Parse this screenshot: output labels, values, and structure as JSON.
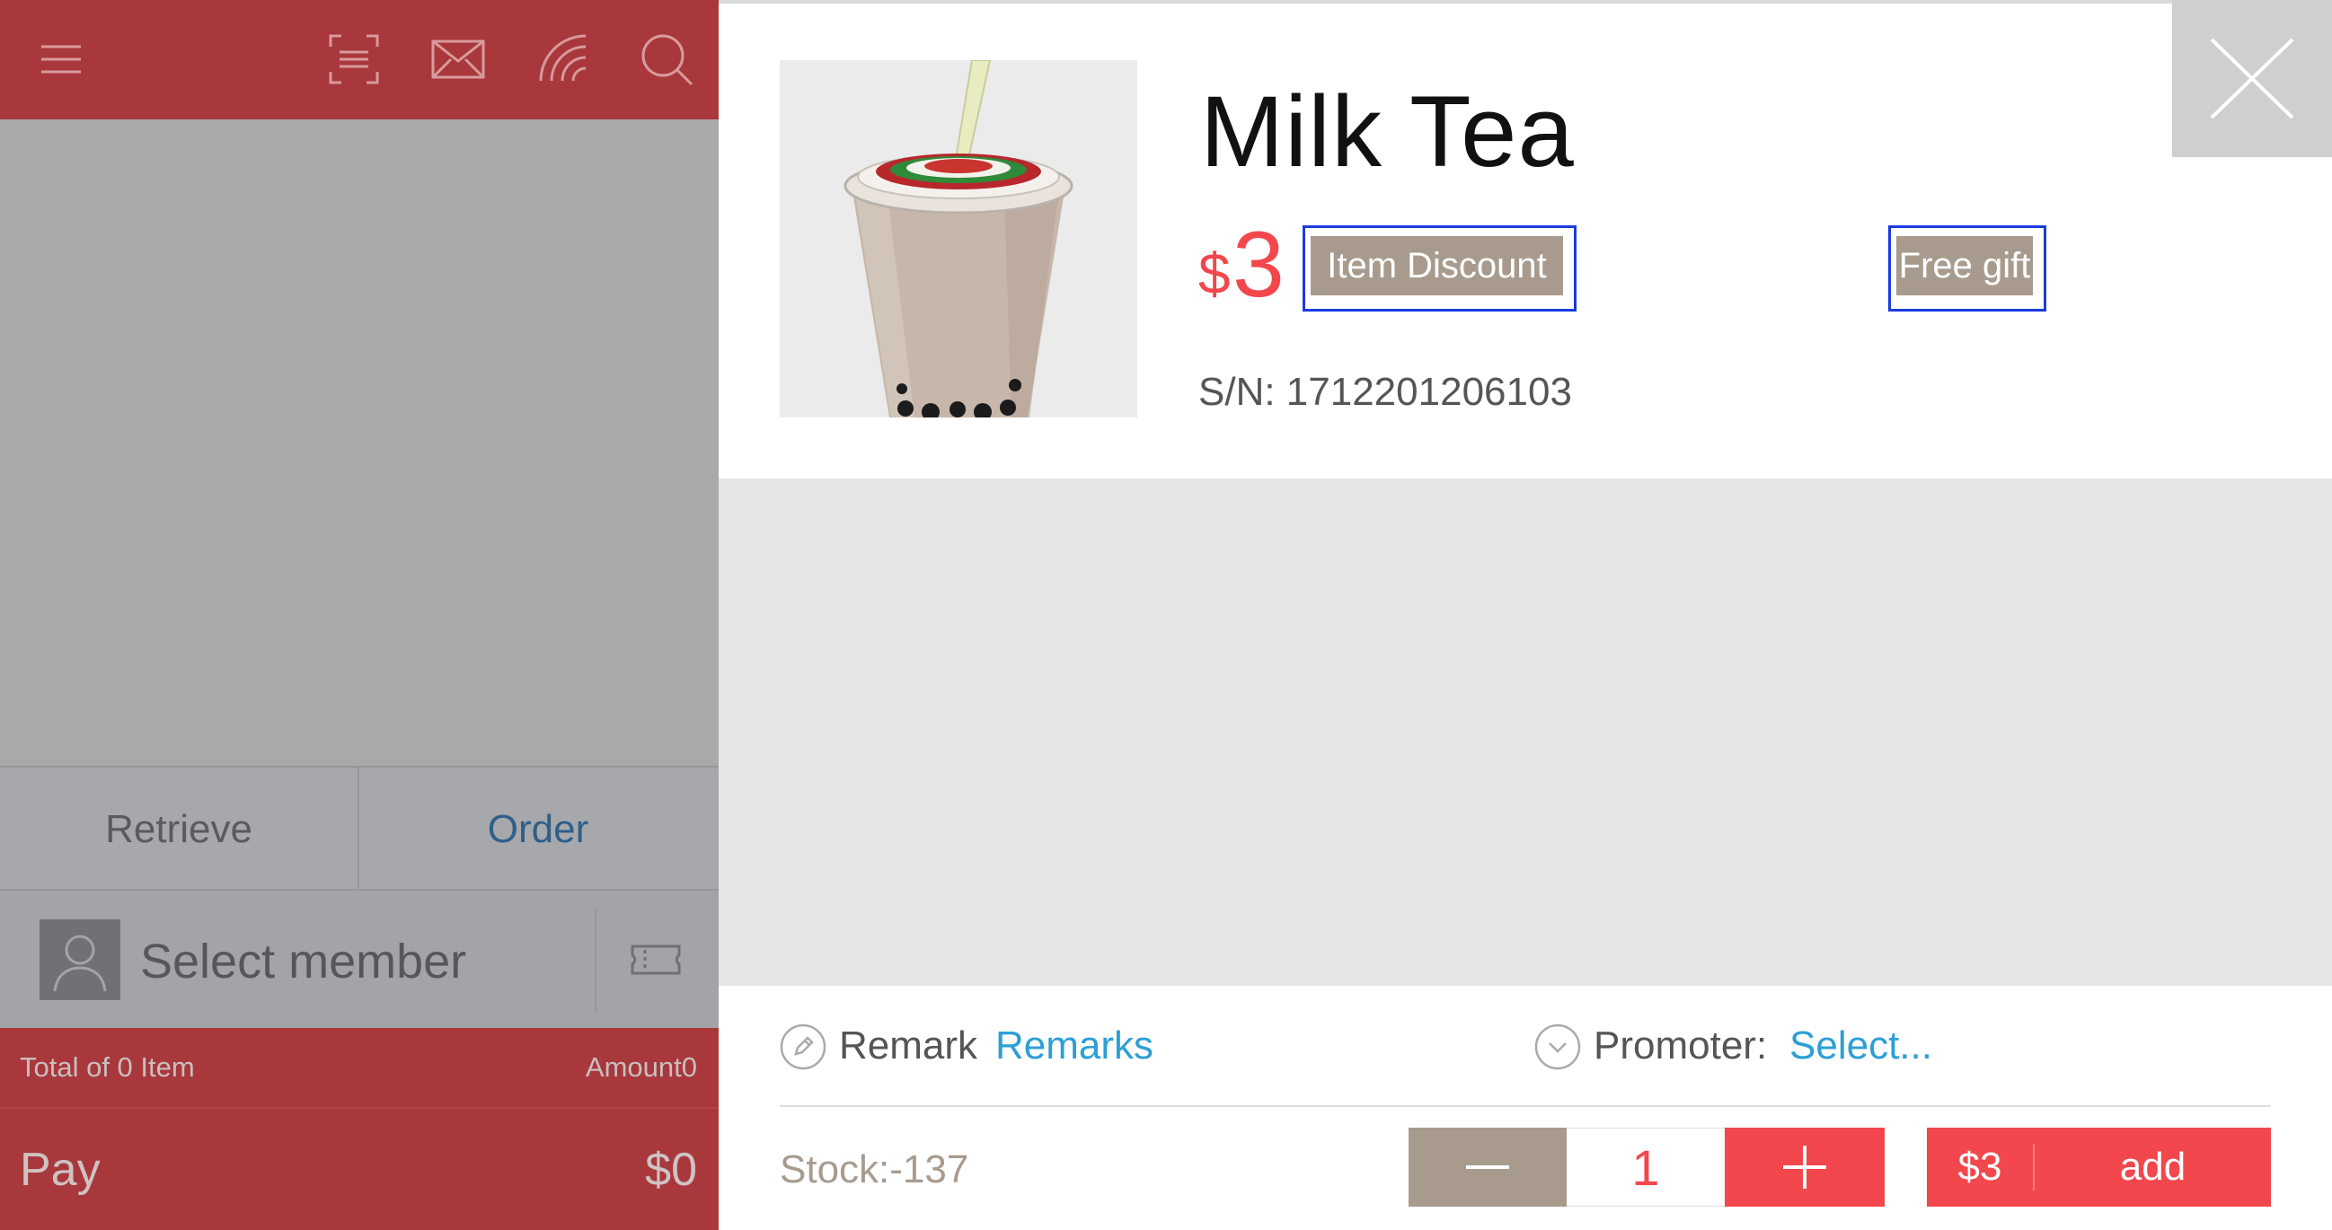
{
  "left_panel": {
    "topbar": {
      "icons": [
        "menu-icon",
        "scan-icon",
        "mail-icon",
        "nfc-icon",
        "search-icon"
      ]
    },
    "tabs": {
      "retrieve": "Retrieve",
      "order": "Order"
    },
    "member": {
      "label": "Select member",
      "icon": "coupon-icon"
    },
    "totals": {
      "items": "Total of 0 Item",
      "amount": "Amount0"
    },
    "pay": {
      "label": "Pay",
      "amount": "$0"
    }
  },
  "product": {
    "name": "Milk Tea",
    "currency": "$",
    "price": "3",
    "tags": {
      "discount": "Item Discount",
      "gift": "Free gift"
    },
    "serial": "S/N: 1712201206103",
    "image": "milk-tea-cup"
  },
  "options": {
    "remark_label": "Remark",
    "remark_link": "Remarks",
    "promoter_label": "Promoter:",
    "promoter_link": "Select..."
  },
  "order_bar": {
    "stock": "Stock:-137",
    "quantity": "1",
    "add_price": "$3",
    "add_label": "add"
  },
  "colors": {
    "brand_red": "#a8383c",
    "accent_red": "#f2474c",
    "tag_tan": "#a89b8e",
    "link_blue": "#2d9fd6",
    "highlight_blue": "#1a3be0"
  }
}
